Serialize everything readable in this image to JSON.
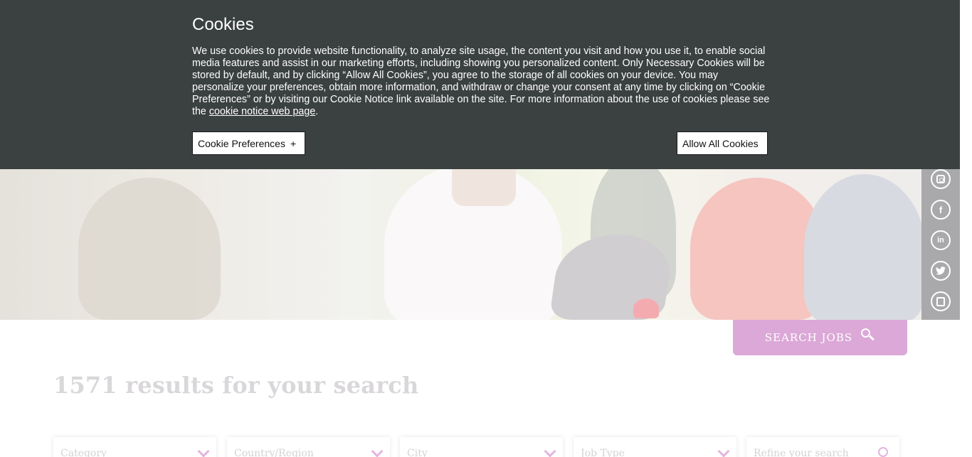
{
  "cookie_banner": {
    "title": "Cookies",
    "body_text": "We use cookies to provide website functionality, to analyze site usage, the content you visit and how you use it, to enable social media features and assist in our marketing efforts, including showing you personalized content. Only Necessary Cookies will be stored by default, and by clicking “Allow All Cookies”, you agree to the storage of all cookies on your device. You may personalize your preferences, obtain more information, and withdraw or change your consent at any time by clicking on “Cookie Preferences” or by visiting our Cookie Notice link available on the site. For more information about the use of cookies please see the ",
    "link_text": "cookie notice web page",
    "trailing": ".",
    "preferences_label": "Cookie Preferences",
    "preferences_symbol": "+",
    "allow_label": "Allow All Cookies"
  },
  "social": {
    "icons": [
      "instagram-icon",
      "facebook-icon",
      "linkedin-icon",
      "twitter-icon",
      "glassdoor-icon"
    ],
    "facebook_glyph": "f",
    "linkedin_glyph": "in"
  },
  "search": {
    "button_label": "SEARCH JOBS"
  },
  "results": {
    "title": "1571 results for your search"
  },
  "filters": {
    "category": "Category",
    "country": "Country/Region",
    "city": "City",
    "job_type": "Job Type",
    "refine_placeholder": "Refine your search"
  },
  "colors": {
    "banner_bg": "#3b4040",
    "accent": "#dba8d7",
    "sidebar": "#a9a9ab"
  }
}
